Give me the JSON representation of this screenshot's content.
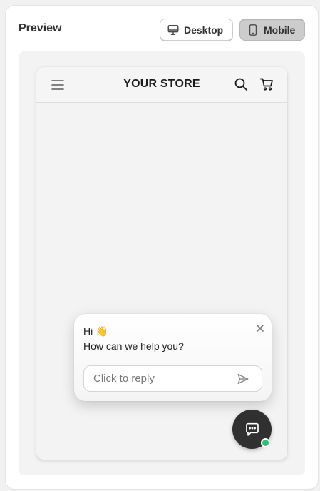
{
  "card": {
    "title": "Preview"
  },
  "view_toggle": {
    "desktop_label": "Desktop",
    "mobile_label": "Mobile",
    "selected": "Mobile"
  },
  "store": {
    "name": "YOUR STORE"
  },
  "chat": {
    "greeting": "Hi 👋",
    "message": "How can we help you?",
    "reply_placeholder": "Click to reply",
    "online_status_color": "#2fbf71"
  },
  "icons": {
    "menu": "hamburger-icon",
    "search": "search-icon",
    "cart": "cart-icon",
    "close": "close-icon",
    "send": "send-icon",
    "chat": "chat-bubble-icon",
    "desktop": "monitor-icon",
    "mobile": "phone-icon"
  },
  "colors": {
    "page_bg": "#f1f1f1",
    "card_bg": "#ffffff",
    "stage_bg": "#f3f3f3",
    "selected_toggle_bg": "#cccccc",
    "launcher_bg": "#303030",
    "text": "#303030"
  }
}
